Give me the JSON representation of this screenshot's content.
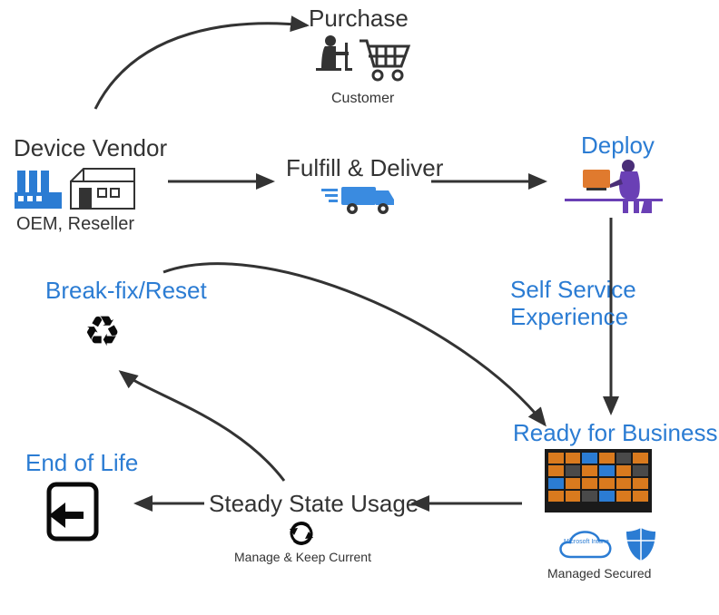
{
  "nodes": {
    "vendor": {
      "title": "Device Vendor",
      "sub": "OEM, Reseller"
    },
    "purchase": {
      "title": "Purchase",
      "sub": "Customer"
    },
    "fulfill": {
      "title": "Fulfill & Deliver"
    },
    "deploy": {
      "title": "Deploy"
    },
    "selfservice": {
      "line1": "Self Service",
      "line2": "Experience"
    },
    "ready": {
      "title": "Ready for Business",
      "sub": "Managed Secured",
      "intune": "Microsoft Intune"
    },
    "steady": {
      "title": "Steady State Usage",
      "sub": "Manage & Keep Current"
    },
    "breakfix": {
      "title": "Break-fix/Reset"
    },
    "eol": {
      "title": "End of Life"
    }
  },
  "colors": {
    "blue": "#2b7cd3",
    "dark": "#333333",
    "truck": "#3a8be0"
  }
}
